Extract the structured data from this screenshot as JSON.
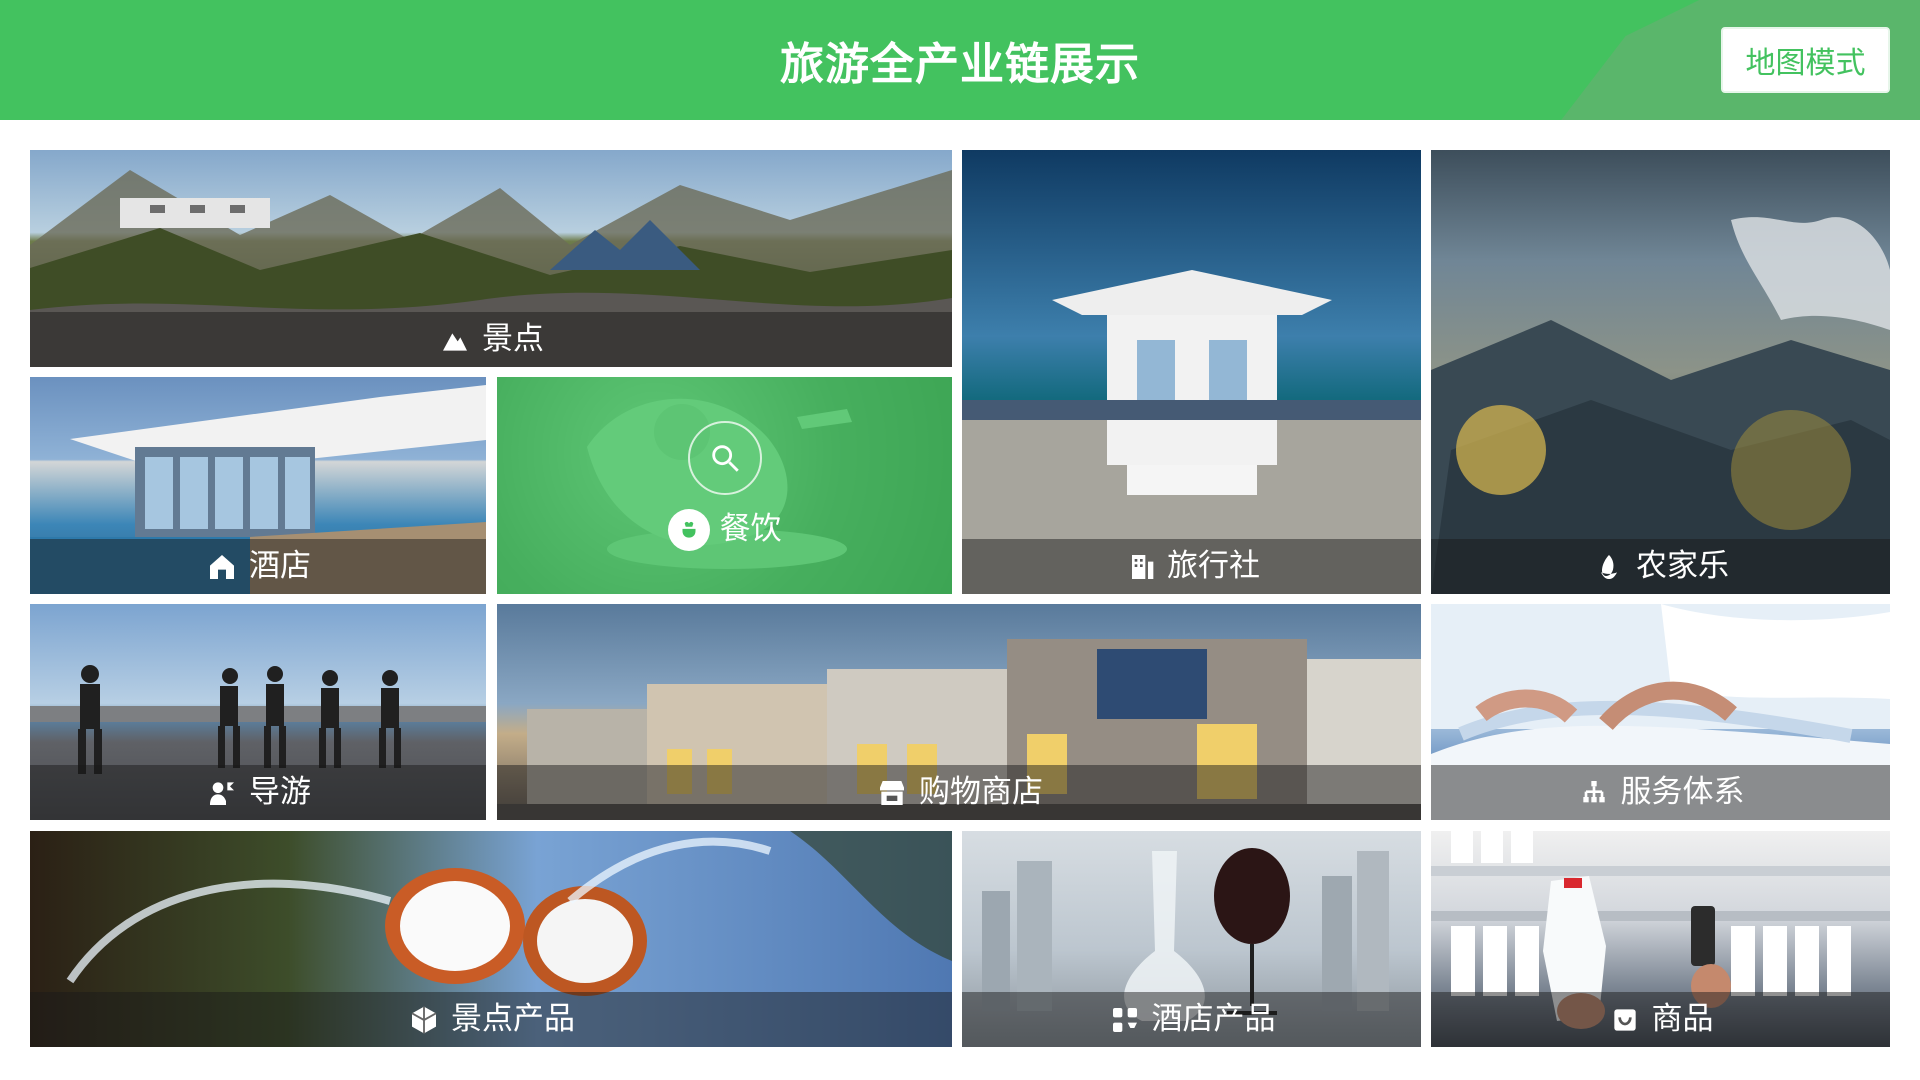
{
  "header": {
    "title": "旅游全产业链展示",
    "map_button": "地图模式"
  },
  "tiles": [
    {
      "label": "景点",
      "icon": "mountain-icon"
    },
    {
      "label": "酒店",
      "icon": "home-icon"
    },
    {
      "label": "餐饮",
      "icon": "dining-icon",
      "active": true
    },
    {
      "label": "旅行社",
      "icon": "building-icon"
    },
    {
      "label": "农家乐",
      "icon": "corn-icon"
    },
    {
      "label": "导游",
      "icon": "guide-icon"
    },
    {
      "label": "购物商店",
      "icon": "store-icon"
    },
    {
      "label": "服务体系",
      "icon": "network-icon"
    },
    {
      "label": "景点产品",
      "icon": "cube-icon"
    },
    {
      "label": "酒店产品",
      "icon": "apps-icon"
    },
    {
      "label": "商品",
      "icon": "bag-icon"
    }
  ],
  "colors": {
    "primary": "#43c25f",
    "overlay": "#191919"
  }
}
